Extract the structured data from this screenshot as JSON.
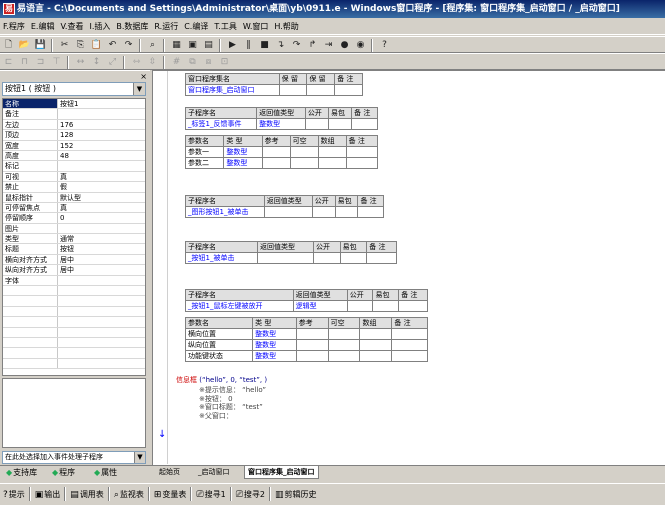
{
  "window": {
    "title": "易语言 - C:\\Documents and Settings\\Administrator\\桌面\\yb\\0911.e - Windows窗口程序 - [程序集: 窗口程序集_启动窗口 / _启动窗口]",
    "app_icon": "易"
  },
  "menu": [
    "F.程序",
    "E.编辑",
    "V.查看",
    "I.插入",
    "B.数据库",
    "R.运行",
    "C.编译",
    "T.工具",
    "W.窗口",
    "H.帮助"
  ],
  "toolbar1": {
    "icons": [
      {
        "name": "new-file-icon",
        "glyph": "🗋"
      },
      {
        "name": "open-folder-icon",
        "glyph": "📂"
      },
      {
        "name": "save-icon",
        "glyph": "💾"
      },
      {
        "name": "sep"
      },
      {
        "name": "cut-icon",
        "glyph": "✂"
      },
      {
        "name": "copy-icon",
        "glyph": "⎘"
      },
      {
        "name": "paste-icon",
        "glyph": "📋"
      },
      {
        "name": "undo-icon",
        "glyph": "↶"
      },
      {
        "name": "redo-icon",
        "glyph": "↷"
      },
      {
        "name": "sep"
      },
      {
        "name": "find-icon",
        "glyph": "⌕"
      },
      {
        "name": "sep"
      },
      {
        "name": "layout-icon",
        "glyph": "▦"
      },
      {
        "name": "panel-icon",
        "glyph": "▣"
      },
      {
        "name": "window-icon",
        "glyph": "▤"
      },
      {
        "name": "sep"
      },
      {
        "name": "run-icon",
        "glyph": "▶"
      },
      {
        "name": "pause-icon",
        "glyph": "‖"
      },
      {
        "name": "stop-icon",
        "glyph": "■"
      },
      {
        "name": "step-into-icon",
        "glyph": "↴"
      },
      {
        "name": "step-over-icon",
        "glyph": "↷"
      },
      {
        "name": "step-out-icon",
        "glyph": "↱"
      },
      {
        "name": "run-to-cursor-icon",
        "glyph": "⇥"
      },
      {
        "name": "breakpoint-icon",
        "glyph": "●"
      },
      {
        "name": "watch-icon",
        "glyph": "◉"
      },
      {
        "name": "sep"
      },
      {
        "name": "help-icon",
        "glyph": "?"
      }
    ]
  },
  "toolbar2": {
    "icons": [
      {
        "name": "align-left-icon",
        "glyph": "⊏"
      },
      {
        "name": "align-center-icon",
        "glyph": "⊓"
      },
      {
        "name": "align-right-icon",
        "glyph": "⊐"
      },
      {
        "name": "align-top-icon",
        "glyph": "⊤"
      },
      {
        "name": "sep"
      },
      {
        "name": "same-width-icon",
        "glyph": "↔"
      },
      {
        "name": "same-height-icon",
        "glyph": "↕"
      },
      {
        "name": "same-size-icon",
        "glyph": "⤢"
      },
      {
        "name": "sep"
      },
      {
        "name": "h-space-icon",
        "glyph": "⇿"
      },
      {
        "name": "v-space-icon",
        "glyph": "⇳"
      },
      {
        "name": "sep"
      },
      {
        "name": "grid-icon",
        "glyph": "#"
      },
      {
        "name": "bring-front-icon",
        "glyph": "⧉"
      },
      {
        "name": "send-back-icon",
        "glyph": "⧈"
      },
      {
        "name": "lock-icon",
        "glyph": "⊡"
      }
    ]
  },
  "leftpanel": {
    "close_glyph": "×",
    "component_select": "按钮1 ( 按钮 )",
    "properties": [
      {
        "name": "名称",
        "value": "按钮1",
        "selected": true
      },
      {
        "name": "备注",
        "value": ""
      },
      {
        "name": "左边",
        "value": "176"
      },
      {
        "name": "顶边",
        "value": "128"
      },
      {
        "name": "宽度",
        "value": "152"
      },
      {
        "name": "高度",
        "value": "48"
      },
      {
        "name": "标记",
        "value": ""
      },
      {
        "name": "可视",
        "value": "真"
      },
      {
        "name": "禁止",
        "value": "假"
      },
      {
        "name": "鼠标指针",
        "value": "默认型"
      },
      {
        "name": "可停留焦点",
        "value": "真"
      },
      {
        "name": "  停留顺序",
        "value": "0"
      },
      {
        "name": "图片",
        "value": ""
      },
      {
        "name": "类型",
        "value": "通常"
      },
      {
        "name": "标题",
        "value": "按钮"
      },
      {
        "name": "横向对齐方式",
        "value": "居中"
      },
      {
        "name": "纵向对齐方式",
        "value": "居中"
      },
      {
        "name": "字体",
        "value": ""
      },
      {
        "name": "",
        "value": ""
      },
      {
        "name": "",
        "value": ""
      },
      {
        "name": "",
        "value": ""
      },
      {
        "name": "",
        "value": ""
      },
      {
        "name": "",
        "value": ""
      },
      {
        "name": "",
        "value": ""
      },
      {
        "name": "",
        "value": ""
      },
      {
        "name": "",
        "value": ""
      }
    ],
    "event_select": "在此处选择加入事件处理子程序",
    "tabs": [
      "支持库",
      "程序",
      "属性"
    ]
  },
  "editor": {
    "assembly": {
      "headers": [
        "窗口程序集名",
        "保 留",
        "保 留",
        "备 注"
      ],
      "row": [
        "窗口程序集_启动窗口",
        "",
        "",
        ""
      ]
    },
    "sub1": {
      "headers": [
        "子程序名",
        "返回值类型",
        "公开",
        "易包",
        "备 注"
      ],
      "row": [
        "_标签1_反馈事件",
        "整数型",
        "",
        "",
        ""
      ],
      "param_headers": [
        "参数名",
        "类 型",
        "参考",
        "可空",
        "数组",
        "备 注"
      ],
      "params": [
        [
          "参数一",
          "整数型",
          "",
          "",
          "",
          ""
        ],
        [
          "参数二",
          "整数型",
          "",
          "",
          "",
          ""
        ]
      ]
    },
    "sub2": {
      "headers": [
        "子程序名",
        "返回值类型",
        "公开",
        "易包",
        "备 注"
      ],
      "row": [
        "_图形按钮1_被单击",
        "",
        "",
        "",
        ""
      ]
    },
    "sub3": {
      "headers": [
        "子程序名",
        "返回值类型",
        "公开",
        "易包",
        "备 注"
      ],
      "row": [
        "_按钮1_被单击",
        "",
        "",
        "",
        ""
      ]
    },
    "sub4": {
      "headers": [
        "子程序名",
        "返回值类型",
        "公开",
        "易包",
        "备 注"
      ],
      "row": [
        "_按钮1_鼠标左键被放开",
        "逻辑型",
        "",
        "",
        ""
      ],
      "param_headers": [
        "参数名",
        "类 型",
        "参考",
        "可空",
        "数组",
        "备 注"
      ],
      "params": [
        [
          "横向位置",
          "整数型",
          "",
          "",
          "",
          ""
        ],
        [
          "纵向位置",
          "整数型",
          "",
          "",
          "",
          ""
        ],
        [
          "功能键状态",
          "整数型",
          "",
          "",
          "",
          ""
        ]
      ]
    },
    "code": {
      "call_name": "信息框",
      "call_args": " (“hello”, 0, “test”, )",
      "hint_lines": [
        "※提示信息： “hello”",
        "※按钮： 0",
        "※窗口标题： “test”",
        "※父窗口："
      ]
    },
    "tabs": [
      "起始页",
      "_启动窗口",
      "窗口程序集_启动窗口"
    ]
  },
  "bottombar": [
    {
      "label": "提示",
      "icon": "?"
    },
    {
      "label": "输出",
      "icon": "▣"
    },
    {
      "label": "调用表",
      "icon": "▤"
    },
    {
      "label": "监视表",
      "icon": "⌕"
    },
    {
      "label": "变量表",
      "icon": "⊞"
    },
    {
      "label": "搜寻1",
      "icon": "⎚"
    },
    {
      "label": "搜寻2",
      "icon": "⎚"
    },
    {
      "label": "剪辑历史",
      "icon": "▥"
    }
  ]
}
